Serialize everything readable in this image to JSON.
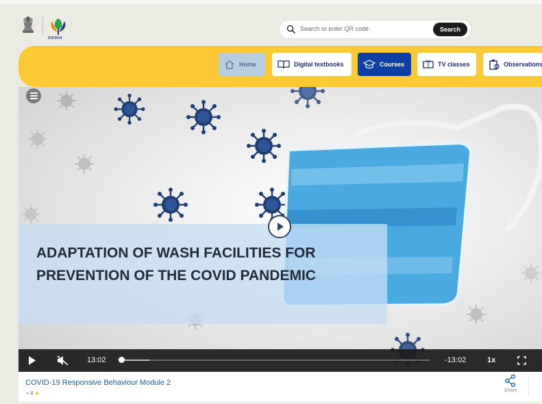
{
  "header": {
    "logo_text": "DIKSHA",
    "search_placeholder": "Search or enter QR code",
    "search_button": "Search"
  },
  "nav": {
    "items": [
      {
        "label": "Home",
        "icon": "home-icon",
        "state": "hover"
      },
      {
        "label": "Digital textbooks",
        "icon": "book-icon",
        "state": "default"
      },
      {
        "label": "Courses",
        "icon": "graduation-cap-icon",
        "state": "active"
      },
      {
        "label": "TV classes",
        "icon": "tv-icon",
        "state": "default"
      },
      {
        "label": "Observations",
        "icon": "clipboard-icon",
        "state": "default"
      }
    ]
  },
  "player": {
    "caption": "ADAPTATION OF WASH FACILITIES FOR  PREVENTION OF THE COVID PANDEMIC",
    "current_time": "13:02",
    "remaining_time": "-13:02",
    "speed": "1x",
    "progress": 0.09,
    "muted": true
  },
  "course": {
    "title": "COVID-19 Responsive Behaviour Module 2",
    "rating": "4",
    "share_label": "Share"
  },
  "colors": {
    "nav_band": "#fbc934",
    "active_nav": "#0f3fa5",
    "link": "#1d5ea8"
  }
}
